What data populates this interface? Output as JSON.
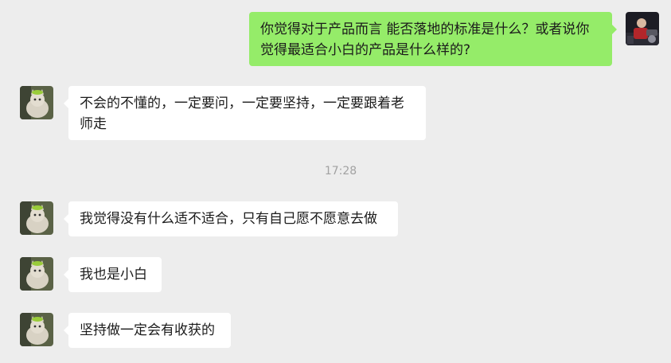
{
  "messages": [
    {
      "side": "right",
      "sender": "self",
      "lines": [
        "你觉得对于产品而言 能否落地的标准是什么？或者说你",
        "觉得最适合小白的产品是什么样的?"
      ]
    },
    {
      "side": "left",
      "sender": "other",
      "lines": [
        "不会的不懂的，一定要问，一定要坚持，一定要跟着老",
        "师走"
      ]
    },
    {
      "side": "left",
      "sender": "other",
      "lines": [
        "我觉得没有什么适不适合，只有自己愿不愿意去做"
      ]
    },
    {
      "side": "left",
      "sender": "other",
      "lines": [
        "我也是小白"
      ]
    },
    {
      "side": "left",
      "sender": "other",
      "lines": [
        "坚持做一定会有收获的"
      ]
    }
  ],
  "timestamp": "17:28",
  "colors": {
    "background": "#ededed",
    "self_bubble": "#95ec69",
    "other_bubble": "#ffffff",
    "timestamp_text": "#a2a2a2"
  }
}
